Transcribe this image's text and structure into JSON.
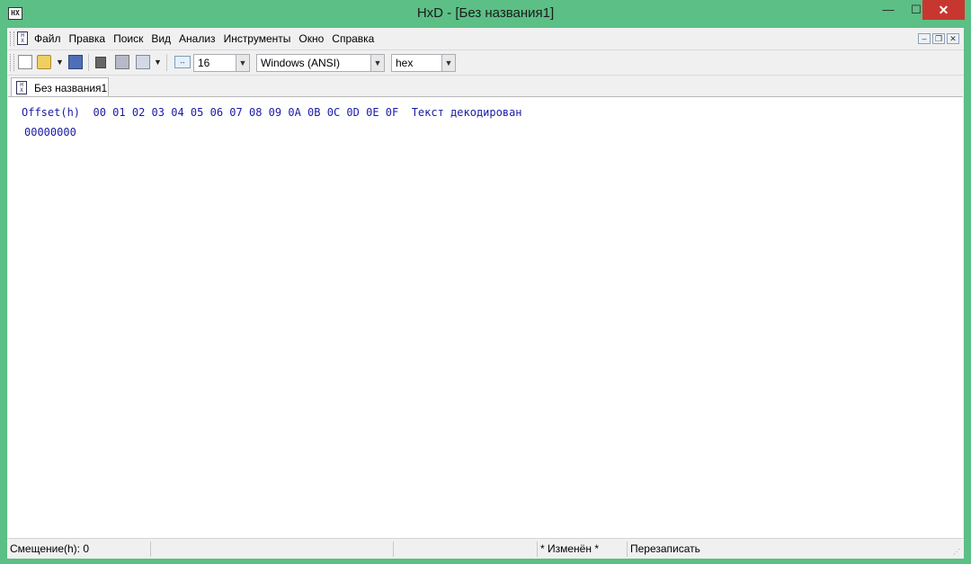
{
  "window": {
    "title": "HxD - [Без названия1]",
    "app_icon_text": "HX",
    "buttons": {
      "minimize": "—",
      "maximize": "☐",
      "close": "✕"
    }
  },
  "colors": {
    "frame": "#5cbf85",
    "close_button": "#c7372f",
    "hex_text": "#1a1aa6"
  },
  "menubar": {
    "items": [
      "Файл",
      "Правка",
      "Поиск",
      "Вид",
      "Анализ",
      "Инструменты",
      "Окно",
      "Справка"
    ],
    "mdi_buttons": {
      "minimize": "–",
      "restore": "❐",
      "close": "✕"
    }
  },
  "toolbar": {
    "icons": [
      "new-file-icon",
      "open-file-icon",
      "save-icon",
      "disk-icon",
      "ram-icon",
      "file-info-icon",
      "bytes-per-row-icon"
    ],
    "bytes_per_row": "16",
    "charset": "Windows (ANSI)",
    "offset_base": "hex"
  },
  "tabs": [
    {
      "label": "Без названия1"
    }
  ],
  "editor": {
    "offset_header": "Offset(h)",
    "column_headers": [
      "00",
      "01",
      "02",
      "03",
      "04",
      "05",
      "06",
      "07",
      "08",
      "09",
      "0A",
      "0B",
      "0C",
      "0D",
      "0E",
      "0F"
    ],
    "decoded_header": "Текст декодирован",
    "rows": [
      {
        "offset": "00000000"
      }
    ]
  },
  "statusbar": {
    "offset": "Смещение(h): 0",
    "panel2": "",
    "panel3": "",
    "modified": "* Изменён *",
    "mode": "Перезаписать"
  }
}
